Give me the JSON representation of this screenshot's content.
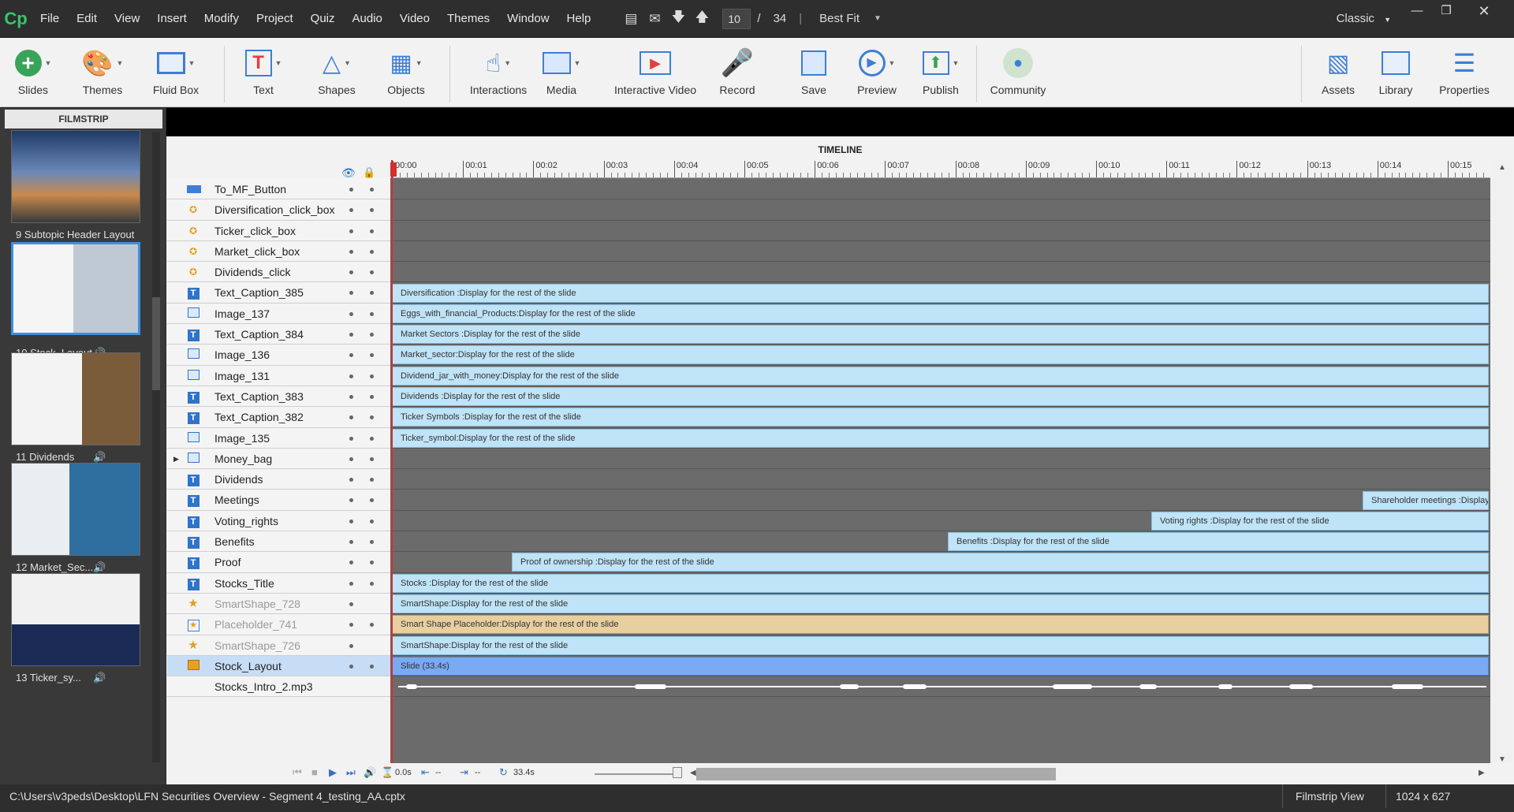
{
  "app": {
    "logo": "Cp"
  },
  "menu": [
    "File",
    "Edit",
    "View",
    "Insert",
    "Modify",
    "Project",
    "Quiz",
    "Audio",
    "Video",
    "Themes",
    "Window",
    "Help"
  ],
  "nav": {
    "current_slide": "10",
    "separator": "/",
    "total_slides": "34",
    "zoom": "Best Fit",
    "layout_mode": "Classic"
  },
  "window_buttons": [
    "minimize",
    "maximize",
    "close"
  ],
  "ribbon": [
    {
      "label": "Slides",
      "icon": "add-slide-icon"
    },
    {
      "label": "Themes",
      "icon": "palette-icon"
    },
    {
      "label": "Fluid Box",
      "icon": "fluid-box-icon"
    },
    {
      "label": "Text",
      "icon": "text-icon"
    },
    {
      "label": "Shapes",
      "icon": "shapes-icon"
    },
    {
      "label": "Objects",
      "icon": "objects-icon"
    },
    {
      "label": "Interactions",
      "icon": "hand-pointer-icon"
    },
    {
      "label": "Media",
      "icon": "image-icon"
    },
    {
      "label": "Interactive Video",
      "icon": "interactive-video-icon"
    },
    {
      "label": "Record",
      "icon": "microphone-icon"
    },
    {
      "label": "Save",
      "icon": "floppy-icon"
    },
    {
      "label": "Preview",
      "icon": "play-icon"
    },
    {
      "label": "Publish",
      "icon": "publish-icon"
    },
    {
      "label": "Community",
      "icon": "community-icon"
    },
    {
      "label": "Assets",
      "icon": "assets-icon"
    },
    {
      "label": "Library",
      "icon": "library-icon"
    },
    {
      "label": "Properties",
      "icon": "properties-icon"
    }
  ],
  "filmstrip": {
    "title": "FILMSTRIP",
    "slides": [
      {
        "label": "9 Subtopic Header Layout",
        "audio": false,
        "selected": false
      },
      {
        "label": "10 Stock_Layout",
        "audio": true,
        "selected": true
      },
      {
        "label": "11 Dividends",
        "audio": true,
        "selected": false
      },
      {
        "label": "12 Market_Sec...",
        "audio": true,
        "selected": false
      },
      {
        "label": "13 Ticker_sy...",
        "audio": true,
        "selected": false
      }
    ]
  },
  "timeline": {
    "title": "TIMELINE",
    "ticks": [
      "00:00",
      "00:01",
      "00:02",
      "00:03",
      "00:04",
      "00:05",
      "00:06",
      "00:07",
      "00:08",
      "00:09",
      "00:10",
      "00:11",
      "00:12",
      "00:13",
      "00:14",
      "00:15"
    ],
    "layers": [
      {
        "name": "To_MF_Button",
        "type": "button",
        "bar": ""
      },
      {
        "name": "Diversification_click_box",
        "type": "clickbox",
        "bar": ""
      },
      {
        "name": "Ticker_click_box",
        "type": "clickbox",
        "bar": ""
      },
      {
        "name": "Market_click_box",
        "type": "clickbox",
        "bar": ""
      },
      {
        "name": "Dividends_click",
        "type": "clickbox",
        "bar": ""
      },
      {
        "name": "Text_Caption_385",
        "type": "caption",
        "bar": "Diversification :Display for the rest of the slide"
      },
      {
        "name": "Image_137",
        "type": "image",
        "bar": "Eggs_with_financial_Products:Display for the rest of the slide"
      },
      {
        "name": "Text_Caption_384",
        "type": "caption",
        "bar": "Market Sectors :Display for the rest of the slide"
      },
      {
        "name": "Image_136",
        "type": "image",
        "bar": "Market_sector:Display for the rest of the slide"
      },
      {
        "name": "Image_131",
        "type": "image",
        "bar": "Dividend_jar_with_money:Display for the rest of the slide"
      },
      {
        "name": "Text_Caption_383",
        "type": "caption",
        "bar": "Dividends :Display for the rest of the slide"
      },
      {
        "name": "Text_Caption_382",
        "type": "caption",
        "bar": "Ticker Symbols :Display for the rest of the slide"
      },
      {
        "name": "Image_135",
        "type": "image",
        "bar": "Ticker_symbol:Display for the rest of the slide"
      },
      {
        "name": "Money_bag",
        "type": "image",
        "bar": "",
        "expandable": true
      },
      {
        "name": "Dividends",
        "type": "caption",
        "bar": ""
      },
      {
        "name": "Meetings",
        "type": "caption",
        "bar": "Shareholder meetings :Display for",
        "start": 13.8
      },
      {
        "name": "Voting_rights",
        "type": "caption",
        "bar": "Voting rights :Display for the rest of the slide",
        "start": 10.8
      },
      {
        "name": "Benefits",
        "type": "caption",
        "bar": "Benefits :Display for the rest of the slide",
        "start": 7.9
      },
      {
        "name": "Proof",
        "type": "caption",
        "bar": "Proof of ownership :Display for the rest of the slide",
        "start": 1.7
      },
      {
        "name": "Stocks_Title",
        "type": "caption",
        "bar": "Stocks :Display for the rest of the slide"
      },
      {
        "name": "SmartShape_728",
        "type": "smartshape",
        "bar": "SmartShape:Display for the rest of the slide",
        "dim": true
      },
      {
        "name": "Placeholder_741",
        "type": "placeholder",
        "bar": "Smart Shape Placeholder:Display for the rest of the slide",
        "dim": true,
        "style": "orange"
      },
      {
        "name": "SmartShape_726",
        "type": "smartshape",
        "bar": "SmartShape:Display for the rest of the slide",
        "dim": true
      },
      {
        "name": "Stock_Layout",
        "type": "slide",
        "bar": "Slide (33.4s)",
        "selected": true,
        "style": "slide"
      },
      {
        "name": "Stocks_Intro_2.mp3",
        "type": "audio",
        "bar": ""
      }
    ],
    "controls": {
      "current_time": "0.0s",
      "start": "--",
      "duration": "--",
      "slide_duration": "33.4s"
    }
  },
  "status": {
    "path": "C:\\Users\\v3peds\\Desktop\\LFN Securities Overview - Segment 4_testing_AA.cptx",
    "view": "Filmstrip View",
    "size": "1024 x 627"
  },
  "colors": {
    "accent": "#3d8fe0",
    "bar": "#bfe3f7",
    "slide_bar": "#7aaaf1",
    "placeholder_bar": "#e8cf9f",
    "playhead": "#d32f2f",
    "logo": "#37c56a"
  }
}
